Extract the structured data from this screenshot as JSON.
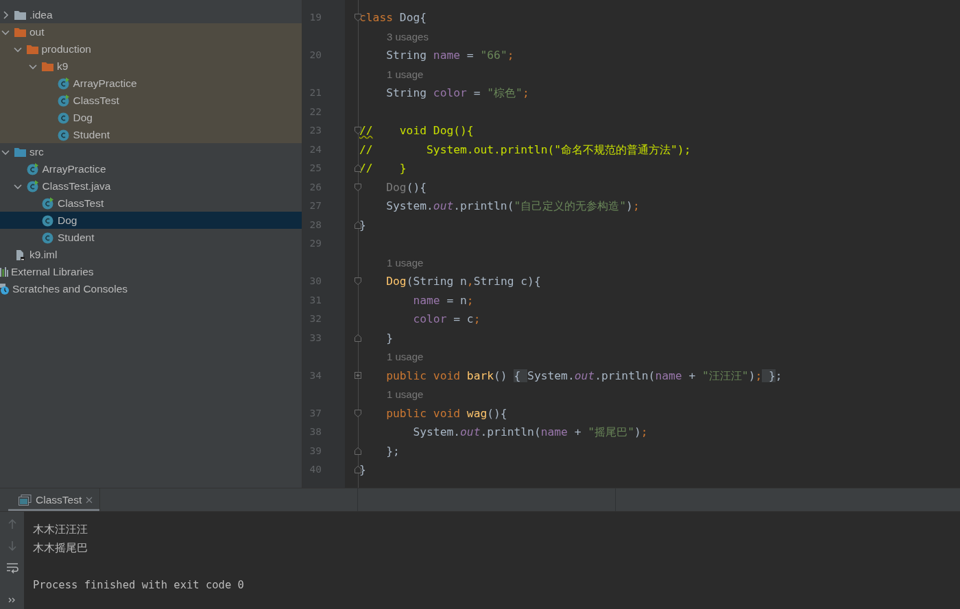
{
  "project_tree": {
    "items": [
      {
        "label": ".idea",
        "kind": "folder",
        "expanded": false,
        "selected": false
      },
      {
        "label": "out",
        "kind": "folder_excluded",
        "expanded": true,
        "excluded": true,
        "selected": false,
        "children": [
          {
            "label": "production",
            "kind": "folder_excluded",
            "expanded": true,
            "selected": false,
            "children": [
              {
                "label": "k9",
                "kind": "folder_excluded",
                "expanded": true,
                "selected": false,
                "children": [
                  {
                    "label": "ArrayPractice",
                    "kind": "class_run",
                    "selected": false
                  },
                  {
                    "label": "ClassTest",
                    "kind": "class_run",
                    "selected": false
                  },
                  {
                    "label": "Dog",
                    "kind": "class",
                    "selected": false
                  },
                  {
                    "label": "Student",
                    "kind": "class",
                    "selected": false
                  }
                ]
              }
            ]
          }
        ]
      },
      {
        "label": "src",
        "kind": "folder_source",
        "expanded": true,
        "selected": false,
        "children": [
          {
            "label": "ArrayPractice",
            "kind": "class_run",
            "selected": false
          },
          {
            "label": "ClassTest.java",
            "kind": "class_run",
            "expanded": true,
            "selected": false,
            "children": [
              {
                "label": "ClassTest",
                "kind": "class_run",
                "selected": false
              },
              {
                "label": "Dog",
                "kind": "class",
                "selected": true
              },
              {
                "label": "Student",
                "kind": "class",
                "selected": false
              }
            ]
          }
        ]
      },
      {
        "label": "k9.iml",
        "kind": "file",
        "selected": false
      }
    ],
    "extra_roots": [
      {
        "label": "External Libraries",
        "kind": "library",
        "selected": false
      },
      {
        "label": "Scratches and Consoles",
        "kind": "scratches",
        "selected": false
      }
    ]
  },
  "editor": {
    "lines": [
      {
        "kind": "code",
        "number": "19",
        "fold": {
          "kind": "start"
        },
        "tokens": [
          {
            "kind": "keyword",
            "text": "class "
          },
          {
            "kind": "plain",
            "text": "Dog{"
          }
        ]
      },
      {
        "kind": "hint",
        "text": "3 usages"
      },
      {
        "kind": "code",
        "number": "20",
        "tokens": [
          {
            "kind": "plain",
            "text": "    String "
          },
          {
            "kind": "field",
            "text": "name"
          },
          {
            "kind": "plain",
            "text": " = "
          },
          {
            "kind": "string",
            "text": "\"66\""
          },
          {
            "kind": "punct",
            "text": ";"
          }
        ]
      },
      {
        "kind": "hint",
        "text": "1 usage"
      },
      {
        "kind": "code",
        "number": "21",
        "tokens": [
          {
            "kind": "plain",
            "text": "    String "
          },
          {
            "kind": "field",
            "text": "color"
          },
          {
            "kind": "plain",
            "text": " = "
          },
          {
            "kind": "string",
            "text": "\"棕色\""
          },
          {
            "kind": "punct",
            "text": ";"
          }
        ]
      },
      {
        "kind": "code",
        "number": "22"
      },
      {
        "kind": "code",
        "number": "23",
        "fold": {
          "kind": "start"
        },
        "tokens": [
          {
            "kind": "comment_typo",
            "text": "//"
          },
          {
            "kind": "comment",
            "text": "    void Dog(){"
          }
        ]
      },
      {
        "kind": "code",
        "number": "24",
        "tokens": [
          {
            "kind": "comment",
            "text": "//        System.out.println(\"命名不规范的普通方法\");"
          }
        ]
      },
      {
        "kind": "code",
        "number": "25",
        "fold": {
          "kind": "end"
        },
        "tokens": [
          {
            "kind": "comment",
            "text": "//    }"
          }
        ]
      },
      {
        "kind": "code",
        "number": "26",
        "fold": {
          "kind": "start"
        },
        "tokens": [
          {
            "kind": "muted",
            "text": "    Dog"
          },
          {
            "kind": "plain",
            "text": "(){"
          }
        ]
      },
      {
        "kind": "code",
        "number": "27",
        "tokens": [
          {
            "kind": "plain",
            "text": "    System."
          },
          {
            "kind": "static",
            "text": "out"
          },
          {
            "kind": "plain",
            "text": ".println("
          },
          {
            "kind": "string",
            "text": "\"自己定义的无参构造\""
          },
          {
            "kind": "plain",
            "text": ")"
          },
          {
            "kind": "punct",
            "text": ";"
          }
        ]
      },
      {
        "kind": "code",
        "number": "28",
        "fold": {
          "kind": "end"
        },
        "tokens": [
          {
            "kind": "plain",
            "text": "}"
          }
        ]
      },
      {
        "kind": "code",
        "number": "29"
      },
      {
        "kind": "hint",
        "text": "1 usage"
      },
      {
        "kind": "code",
        "number": "30",
        "fold": {
          "kind": "start"
        },
        "tokens": [
          {
            "kind": "method",
            "text": "    Dog"
          },
          {
            "kind": "plain",
            "text": "(String n"
          },
          {
            "kind": "punct",
            "text": ","
          },
          {
            "kind": "plain",
            "text": "String c){"
          }
        ]
      },
      {
        "kind": "code",
        "number": "31",
        "tokens": [
          {
            "kind": "field",
            "text": "        name"
          },
          {
            "kind": "plain",
            "text": " = n"
          },
          {
            "kind": "punct",
            "text": ";"
          }
        ]
      },
      {
        "kind": "code",
        "number": "32",
        "tokens": [
          {
            "kind": "field",
            "text": "        color"
          },
          {
            "kind": "plain",
            "text": " = c"
          },
          {
            "kind": "punct",
            "text": ";"
          }
        ]
      },
      {
        "kind": "code",
        "number": "33",
        "fold": {
          "kind": "end"
        },
        "tokens": [
          {
            "kind": "plain",
            "text": "    }"
          }
        ]
      },
      {
        "kind": "hint",
        "text": "1 usage"
      },
      {
        "kind": "code",
        "number": "34",
        "fold": {
          "kind": "collapsed"
        },
        "tokens": [
          {
            "kind": "keyword",
            "text": "    public void "
          },
          {
            "kind": "method",
            "text": "bark"
          },
          {
            "kind": "plain",
            "text": "() "
          },
          {
            "kind": "folded",
            "text": "{ "
          },
          {
            "kind": "plain",
            "text": "System."
          },
          {
            "kind": "static",
            "text": "out"
          },
          {
            "kind": "plain",
            "text": ".println("
          },
          {
            "kind": "field",
            "text": "name"
          },
          {
            "kind": "plain",
            "text": " + "
          },
          {
            "kind": "string",
            "text": "\"汪汪汪\""
          },
          {
            "kind": "plain",
            "text": ")"
          },
          {
            "kind": "punct",
            "text": ";"
          },
          {
            "kind": "folded",
            "text": " }"
          },
          {
            "kind": "plain",
            "text": ";"
          }
        ]
      },
      {
        "kind": "hint",
        "text": "1 usage"
      },
      {
        "kind": "code",
        "number": "37",
        "fold": {
          "kind": "start"
        },
        "tokens": [
          {
            "kind": "keyword",
            "text": "    public void "
          },
          {
            "kind": "method",
            "text": "wag"
          },
          {
            "kind": "plain",
            "text": "(){"
          }
        ]
      },
      {
        "kind": "code",
        "number": "38",
        "tokens": [
          {
            "kind": "plain",
            "text": "        System."
          },
          {
            "kind": "static",
            "text": "out"
          },
          {
            "kind": "plain",
            "text": ".println("
          },
          {
            "kind": "field",
            "text": "name"
          },
          {
            "kind": "plain",
            "text": " + "
          },
          {
            "kind": "string",
            "text": "\"摇尾巴\""
          },
          {
            "kind": "plain",
            "text": ")"
          },
          {
            "kind": "punct",
            "text": ";"
          }
        ]
      },
      {
        "kind": "code",
        "number": "39",
        "fold": {
          "kind": "end"
        },
        "tokens": [
          {
            "kind": "plain",
            "text": "    };"
          }
        ]
      },
      {
        "kind": "code",
        "number": "40",
        "fold": {
          "kind": "end"
        },
        "tokens": [
          {
            "kind": "plain",
            "text": "}"
          }
        ]
      }
    ]
  },
  "run_panel": {
    "tabs": [
      {
        "label": "ClassTest",
        "selected": true
      }
    ],
    "output": [
      {
        "kind": "stdout",
        "text": "木木汪汪汪"
      },
      {
        "kind": "stdout",
        "text": "木木摇尾巴"
      },
      {
        "kind": "exit",
        "text": "Process finished with exit code 0"
      }
    ]
  }
}
